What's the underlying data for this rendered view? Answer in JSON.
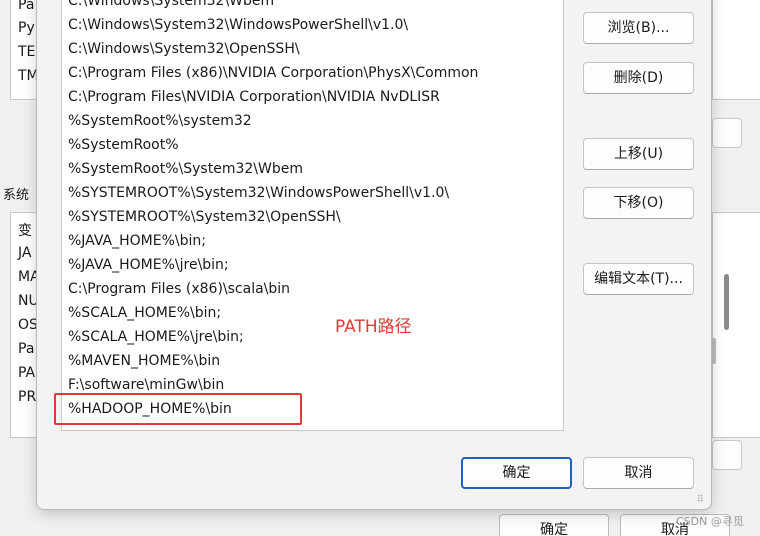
{
  "background": {
    "env_list_items": [
      "Pa",
      "Py",
      "TE",
      "TM"
    ],
    "section_label": "系统",
    "sys_list_items": [
      "变",
      "JA",
      "MA",
      "NU",
      "OS",
      "Pa",
      "PA",
      "PR"
    ],
    "ok_label": "确定",
    "cancel_label": "取消"
  },
  "path_entries": [
    "C:\\Windows\\System32\\Wbem",
    "C:\\Windows\\System32\\WindowsPowerShell\\v1.0\\",
    "C:\\Windows\\System32\\OpenSSH\\",
    "C:\\Program Files (x86)\\NVIDIA Corporation\\PhysX\\Common",
    "C:\\Program Files\\NVIDIA Corporation\\NVIDIA NvDLISR",
    "%SystemRoot%\\system32",
    "%SystemRoot%",
    "%SystemRoot%\\System32\\Wbem",
    "%SYSTEMROOT%\\System32\\WindowsPowerShell\\v1.0\\",
    "%SYSTEMROOT%\\System32\\OpenSSH\\",
    "%JAVA_HOME%\\bin;",
    "%JAVA_HOME%\\jre\\bin;",
    "C:\\Program Files (x86)\\scala\\bin",
    "%SCALA_HOME%\\bin;",
    "%SCALA_HOME%\\jre\\bin;",
    "%MAVEN_HOME%\\bin",
    "F:\\software\\minGw\\bin",
    "%HADOOP_HOME%\\bin"
  ],
  "buttons": {
    "browse": "浏览(B)...",
    "delete": "删除(D)",
    "move_up": "上移(U)",
    "move_down": "下移(O)",
    "edit_text": "编辑文本(T)...",
    "ok": "确定",
    "cancel": "取消"
  },
  "annotation": "PATH路径",
  "watermark": "CSDN @寻觅",
  "colors": {
    "highlight": "#e53935",
    "default_button_border": "#1f5fbf"
  }
}
